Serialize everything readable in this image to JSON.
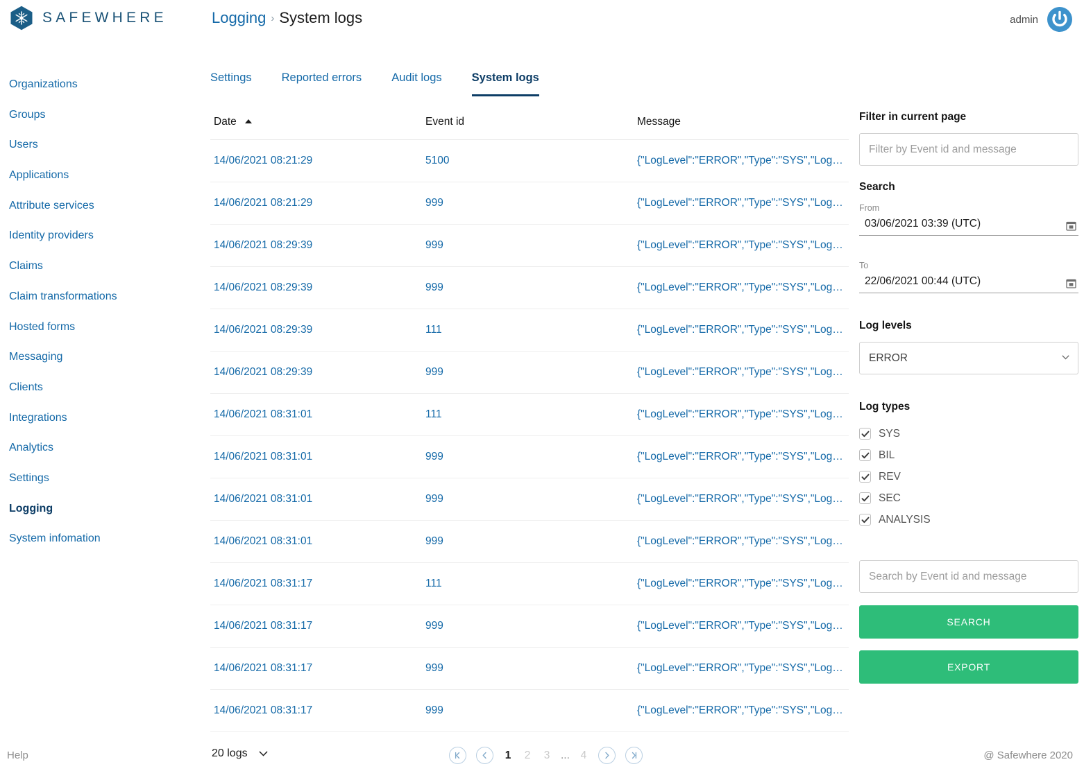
{
  "brand": {
    "name": "SAFEWHERE",
    "logo_icon": "safewhere-hex-logo"
  },
  "breadcrumb": {
    "parent": "Logging",
    "separator": "›",
    "current": "System logs"
  },
  "user": {
    "name": "admin",
    "icon": "power-logout-icon"
  },
  "colors": {
    "link_blue": "#1469a8",
    "brand_navy": "#0d3d66",
    "accent_green": "#2ebd79",
    "muted_gray": "#8d8d8d"
  },
  "sidebar": {
    "items": [
      {
        "label": "Organizations",
        "active": false
      },
      {
        "label": "Groups",
        "active": false
      },
      {
        "label": "Users",
        "active": false
      },
      {
        "label": "Applications",
        "active": false
      },
      {
        "label": "Attribute services",
        "active": false
      },
      {
        "label": "Identity providers",
        "active": false
      },
      {
        "label": "Claims",
        "active": false
      },
      {
        "label": "Claim transformations",
        "active": false
      },
      {
        "label": "Hosted forms",
        "active": false
      },
      {
        "label": "Messaging",
        "active": false
      },
      {
        "label": "Clients",
        "active": false
      },
      {
        "label": "Integrations",
        "active": false
      },
      {
        "label": "Analytics",
        "active": false
      },
      {
        "label": "Settings",
        "active": false
      },
      {
        "label": "Logging",
        "active": true
      },
      {
        "label": "System infomation",
        "active": false
      }
    ]
  },
  "tabs": [
    {
      "label": "Settings",
      "active": false
    },
    {
      "label": "Reported errors",
      "active": false
    },
    {
      "label": "Audit logs",
      "active": false
    },
    {
      "label": "System logs",
      "active": true
    }
  ],
  "table": {
    "columns": [
      {
        "label": "Date",
        "sort": "asc",
        "sort_icon": "sort-ascending-icon"
      },
      {
        "label": "Event id",
        "sort": null
      },
      {
        "label": "Message",
        "sort": null
      }
    ],
    "rows": [
      {
        "date": "14/06/2021 08:21:29",
        "event_id": "5100",
        "message": "{\"LogLevel\":\"ERROR\",\"Type\":\"SYS\",\"LogM…"
      },
      {
        "date": "14/06/2021 08:21:29",
        "event_id": "999",
        "message": "{\"LogLevel\":\"ERROR\",\"Type\":\"SYS\",\"LogM…"
      },
      {
        "date": "14/06/2021 08:29:39",
        "event_id": "999",
        "message": "{\"LogLevel\":\"ERROR\",\"Type\":\"SYS\",\"LogM…"
      },
      {
        "date": "14/06/2021 08:29:39",
        "event_id": "999",
        "message": "{\"LogLevel\":\"ERROR\",\"Type\":\"SYS\",\"LogM…"
      },
      {
        "date": "14/06/2021 08:29:39",
        "event_id": "111",
        "message": "{\"LogLevel\":\"ERROR\",\"Type\":\"SYS\",\"LogM…"
      },
      {
        "date": "14/06/2021 08:29:39",
        "event_id": "999",
        "message": "{\"LogLevel\":\"ERROR\",\"Type\":\"SYS\",\"LogM…"
      },
      {
        "date": "14/06/2021 08:31:01",
        "event_id": "111",
        "message": "{\"LogLevel\":\"ERROR\",\"Type\":\"SYS\",\"LogM…"
      },
      {
        "date": "14/06/2021 08:31:01",
        "event_id": "999",
        "message": "{\"LogLevel\":\"ERROR\",\"Type\":\"SYS\",\"LogM…"
      },
      {
        "date": "14/06/2021 08:31:01",
        "event_id": "999",
        "message": "{\"LogLevel\":\"ERROR\",\"Type\":\"SYS\",\"LogM…"
      },
      {
        "date": "14/06/2021 08:31:01",
        "event_id": "999",
        "message": "{\"LogLevel\":\"ERROR\",\"Type\":\"SYS\",\"LogM…"
      },
      {
        "date": "14/06/2021 08:31:17",
        "event_id": "111",
        "message": "{\"LogLevel\":\"ERROR\",\"Type\":\"SYS\",\"LogM…"
      },
      {
        "date": "14/06/2021 08:31:17",
        "event_id": "999",
        "message": "{\"LogLevel\":\"ERROR\",\"Type\":\"SYS\",\"LogM…"
      },
      {
        "date": "14/06/2021 08:31:17",
        "event_id": "999",
        "message": "{\"LogLevel\":\"ERROR\",\"Type\":\"SYS\",\"LogM…"
      },
      {
        "date": "14/06/2021 08:31:17",
        "event_id": "999",
        "message": "{\"LogLevel\":\"ERROR\",\"Type\":\"SYS\",\"LogM…"
      }
    ]
  },
  "filters": {
    "filter_heading": "Filter in current page",
    "filter_placeholder": "Filter by Event id and message",
    "filter_value": "",
    "search_heading": "Search",
    "from_label": "From",
    "from_value": "03/06/2021 03:39 (UTC)",
    "to_label": "To",
    "to_value": "22/06/2021 00:44 (UTC)",
    "calendar_icon": "calendar-icon",
    "log_levels_label": "Log levels",
    "log_level_selected": "ERROR",
    "log_level_options": [
      "ERROR"
    ],
    "log_types_label": "Log types",
    "log_types": [
      {
        "label": "SYS",
        "checked": true
      },
      {
        "label": "BIL",
        "checked": true
      },
      {
        "label": "REV",
        "checked": true
      },
      {
        "label": "SEC",
        "checked": true
      },
      {
        "label": "ANALYSIS",
        "checked": true
      }
    ],
    "search_placeholder": "Search by Event id and message",
    "search_value": "",
    "search_button": "SEARCH",
    "export_button": "EXPORT"
  },
  "footer": {
    "help": "Help",
    "copyright": "@ Safewhere 2020",
    "page_size": "20 logs",
    "pagination": {
      "first_icon": "first-page-icon",
      "prev_icon": "previous-page-icon",
      "next_icon": "next-page-icon",
      "last_icon": "last-page-icon",
      "pages": [
        "1",
        "2",
        "3"
      ],
      "ellipsis": "...",
      "last_page": "4",
      "current_page": "1"
    }
  }
}
